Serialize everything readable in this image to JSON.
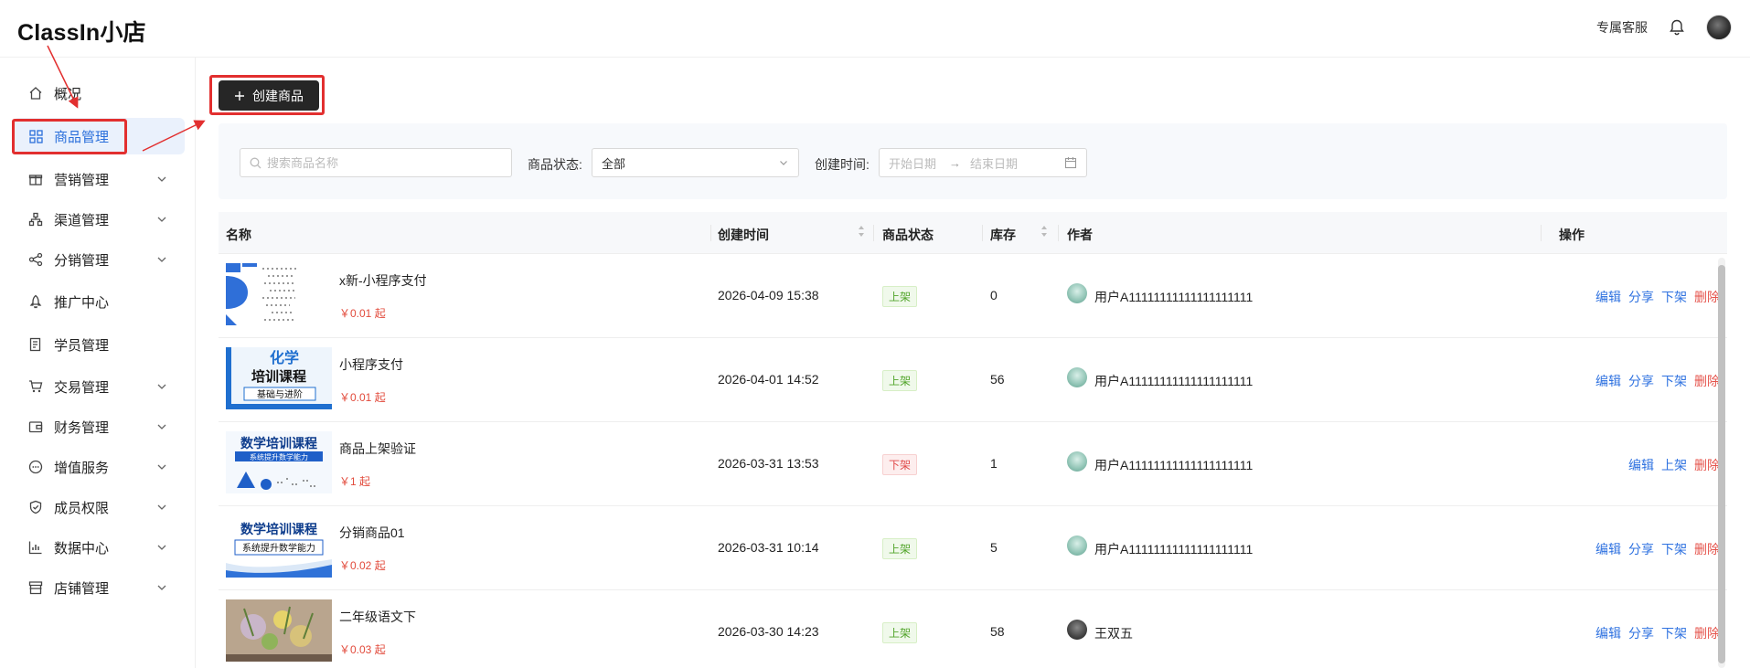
{
  "app": {
    "title": "ClassIn小店"
  },
  "header": {
    "support_label": "专属客服",
    "icons": [
      "bell-icon",
      "avatar"
    ]
  },
  "sidebar": {
    "items": [
      {
        "label": "概况",
        "icon": "home-icon",
        "expandable": false
      },
      {
        "label": "商品管理",
        "icon": "grid-icon",
        "expandable": false,
        "active": true
      },
      {
        "label": "营销管理",
        "icon": "gift-icon",
        "expandable": true
      },
      {
        "label": "渠道管理",
        "icon": "channel-icon",
        "expandable": true
      },
      {
        "label": "分销管理",
        "icon": "share-icon",
        "expandable": true
      },
      {
        "label": "推广中心",
        "icon": "rocket-icon",
        "expandable": false
      },
      {
        "label": "学员管理",
        "icon": "document-icon",
        "expandable": false
      },
      {
        "label": "交易管理",
        "icon": "cart-icon",
        "expandable": true
      },
      {
        "label": "财务管理",
        "icon": "wallet-icon",
        "expandable": true
      },
      {
        "label": "增值服务",
        "icon": "chat-icon",
        "expandable": true
      },
      {
        "label": "成员权限",
        "icon": "shield-icon",
        "expandable": true
      },
      {
        "label": "数据中心",
        "icon": "chart-icon",
        "expandable": true
      },
      {
        "label": "店铺管理",
        "icon": "store-icon",
        "expandable": true
      }
    ],
    "accent_color": "#2a6fdb",
    "active_bg": "#eaf1fc"
  },
  "toolbar": {
    "create_label": "创建商品",
    "create_icon": "plus-icon"
  },
  "filters": {
    "search_placeholder": "搜索商品名称",
    "status_label": "商品状态:",
    "status_value": "全部",
    "created_label": "创建时间:",
    "start_placeholder": "开始日期",
    "end_placeholder": "结束日期"
  },
  "table": {
    "columns": [
      "名称",
      "创建时间",
      "商品状态",
      "库存",
      "作者",
      "操作"
    ],
    "rows": [
      {
        "name": "x新-小程序支付",
        "price": "￥0.01 起",
        "created": "2026-04-09 15:38",
        "status": "上架",
        "stock": "0",
        "author": "用户A11111111111111111111",
        "ops": [
          "编辑",
          "分享",
          "下架",
          "删除"
        ]
      },
      {
        "name": "小程序支付",
        "price": "￥0.01 起",
        "created": "2026-04-01 14:52",
        "status": "上架",
        "stock": "56",
        "author": "用户A11111111111111111111",
        "ops": [
          "编辑",
          "分享",
          "下架",
          "删除"
        ]
      },
      {
        "name": "商品上架验证",
        "price": "￥1 起",
        "created": "2026-03-31 13:53",
        "status": "下架",
        "stock": "1",
        "author": "用户A11111111111111111111",
        "ops": [
          "编辑",
          "上架",
          "删除"
        ]
      },
      {
        "name": "分销商品01",
        "price": "￥0.02 起",
        "created": "2026-03-31 10:14",
        "status": "上架",
        "stock": "5",
        "author": "用户A11111111111111111111",
        "ops": [
          "编辑",
          "分享",
          "下架",
          "删除"
        ]
      },
      {
        "name": "二年级语文下",
        "price": "￥0.03 起",
        "created": "2026-03-30 14:23",
        "status": "上架",
        "stock": "58",
        "author": "王双五",
        "ops": [
          "编辑",
          "分享",
          "下架",
          "删除"
        ]
      }
    ],
    "thumbnails": {
      "t2": {
        "line1": "化学",
        "line2": "培训课程",
        "line3": "基础与进阶"
      },
      "t3": {
        "line1": "数学培训课程",
        "line2": "系统提升数学能力"
      },
      "t4": {
        "line1": "数学培训课程",
        "line2": "系统提升数学能力"
      }
    }
  },
  "colors": {
    "primary_button": "#262626",
    "highlight": "#e22f2f",
    "link": "#2f72e0",
    "danger": "#e5534b",
    "price": "#e24a3b"
  }
}
